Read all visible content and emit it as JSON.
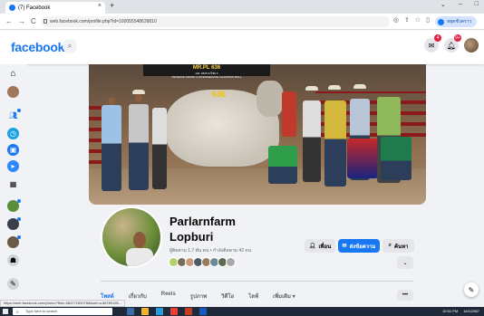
{
  "browser": {
    "tab_title": "(7) Facebook",
    "tab_close": "×",
    "new_tab": "+",
    "window_controls": [
      "⌄",
      "–",
      "□"
    ],
    "address": "web.facebook.com/profile.php?id=100055548639810",
    "profile_label": "หยุดชั่วคราว"
  },
  "facebook": {
    "logo": "facebook",
    "badges": {
      "messenger": "4",
      "notifications": "9+"
    }
  },
  "cover": {
    "banner_title": "MR.PL 636",
    "banner_sub1": "GR. 4825 ธงไชย 3",
    "banner_sub2": "RESERVE GRAND & INTERMEDIATE CHAMPION BULL",
    "bull_number": "636"
  },
  "profile": {
    "name": "Parlarnfarm Lopburi",
    "stats": "ผู้ติดตาม 1.7 พัน คน • กำลังติดตาม 42 คน",
    "buttons": {
      "friends": "เพื่อน",
      "message": "ส่งข้อความ",
      "search": "ค้นหา"
    },
    "more_chevron": "⌄",
    "tabs": [
      "โพสต์",
      "เกี่ยวกับ",
      "Reels",
      "รูปภาพ",
      "วิดีโอ",
      "ไลฟ์",
      "เพิ่มเติม ▾"
    ],
    "tabs_more": "•••"
  },
  "status_url": "https://web.facebook.com/photo/?fbid=582272539768&set=a.86789165...",
  "taskbar": {
    "search_placeholder": "Type here to search",
    "tray_time": "10:51 PM",
    "tray_date": "16/1/2567"
  },
  "colors": {
    "brand": "#1877f2",
    "notify_badge": "#e41e3f",
    "page_bg": "#f0f2f5"
  },
  "icons": [
    "home-icon",
    "search-icon",
    "grid-menu-icon",
    "messenger-icon",
    "bell-icon",
    "compose-icon",
    "windows-start-icon"
  ]
}
